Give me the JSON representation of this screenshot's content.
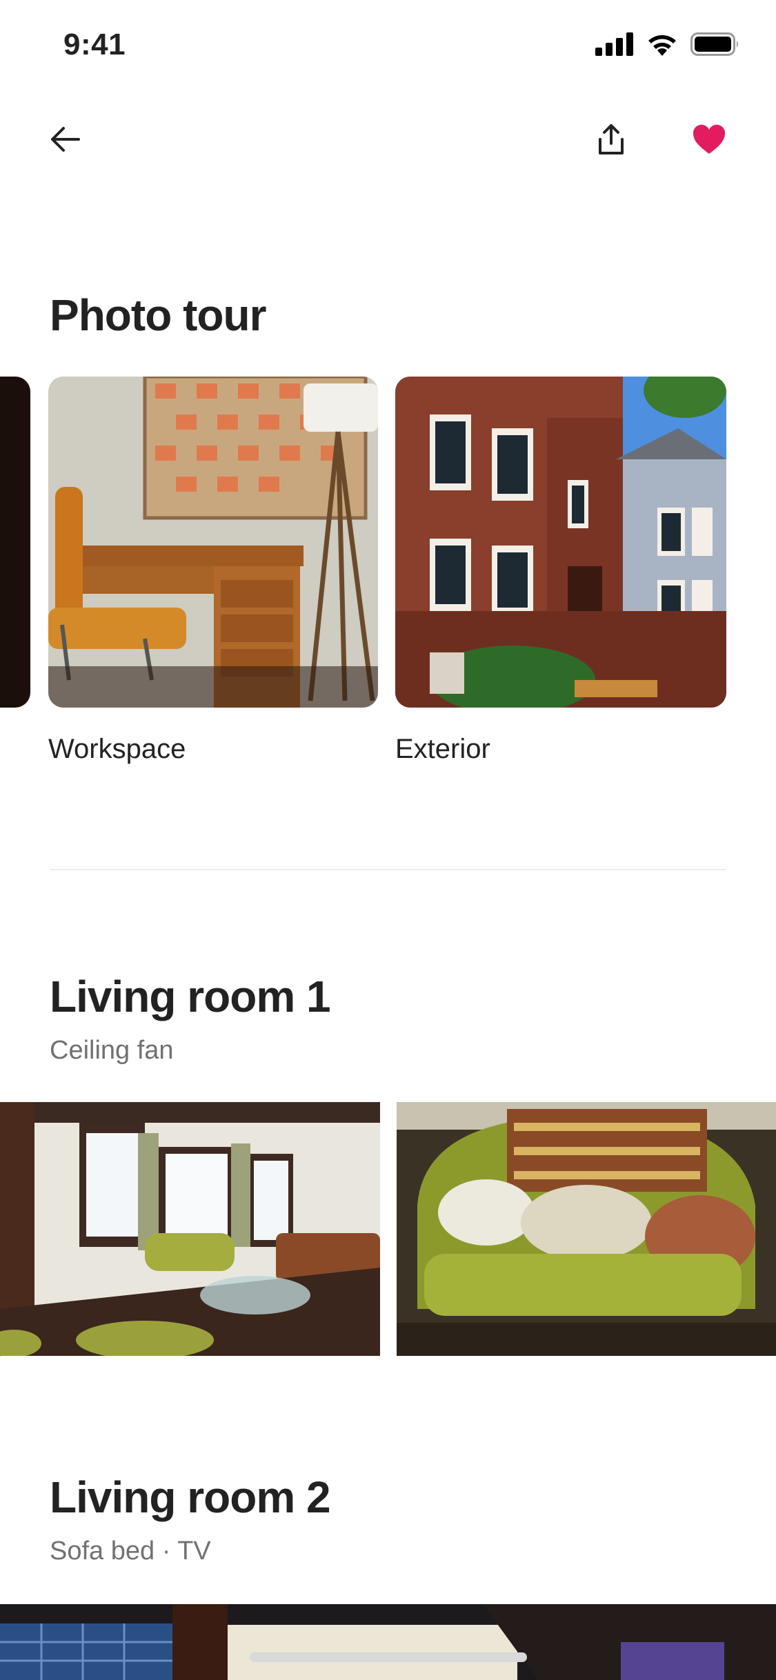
{
  "status_bar": {
    "time": "9:41"
  },
  "nav": {
    "back_icon": "arrow-left-icon",
    "share_icon": "share-icon",
    "favorite_icon": "heart-icon",
    "favorite_color": "#e31c5f"
  },
  "photo_tour": {
    "title": "Photo tour",
    "items": [
      {
        "caption": "Workspace"
      },
      {
        "caption": "Exterior"
      }
    ]
  },
  "sections": [
    {
      "title": "Living room 1",
      "amenities": "Ceiling fan"
    },
    {
      "title": "Living room 2",
      "amenities": "Sofa bed · TV"
    }
  ]
}
